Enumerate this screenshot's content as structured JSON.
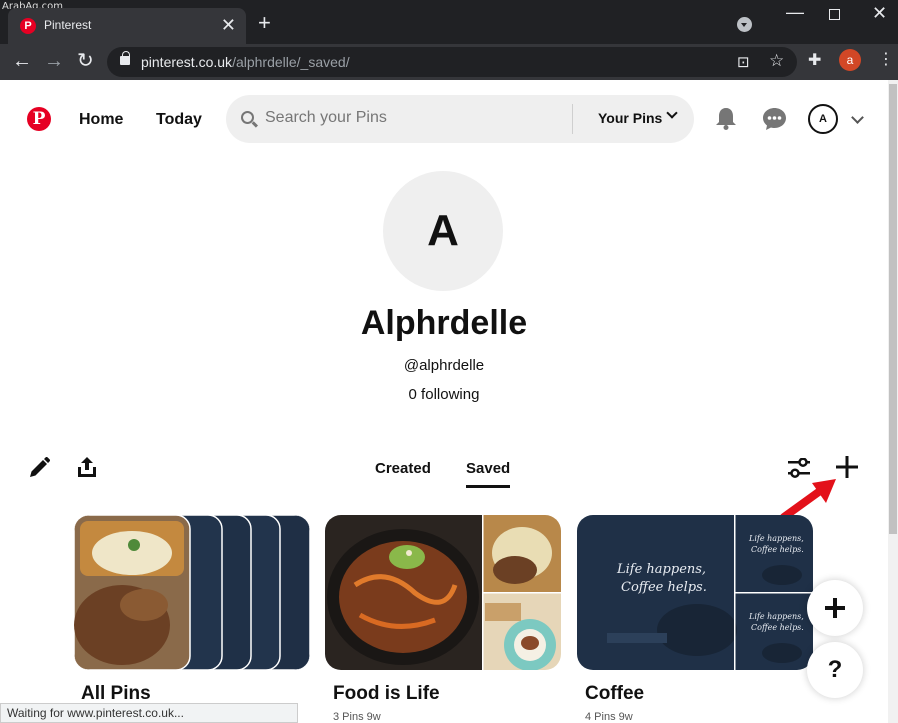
{
  "watermark": "ArabAq.com",
  "browser": {
    "tab_title": "Pinterest",
    "url_host": "pinterest.co.uk",
    "url_path": "/alphrdelle/_saved/",
    "profile_initial": "a",
    "status_text": "Waiting for www.pinterest.co.uk..."
  },
  "header": {
    "logo": "P",
    "nav": {
      "home": "Home",
      "today": "Today"
    },
    "search_placeholder": "Search your Pins",
    "scope": "Your Pins",
    "avatar_initial": "A"
  },
  "profile": {
    "avatar_initial": "A",
    "name": "Alphrdelle",
    "handle": "@alphrdelle",
    "following": "0 following"
  },
  "tabs": {
    "created": "Created",
    "saved": "Saved"
  },
  "boards": [
    {
      "title": "All Pins",
      "meta": ""
    },
    {
      "title": "Food is Life",
      "meta": "3 Pins  9w"
    },
    {
      "title": "Coffee",
      "meta": "4 Pins  9w"
    }
  ],
  "coffee_text": "Life happens, Coffee helps.",
  "fab": {
    "help": "?"
  },
  "colors": {
    "brand": "#e60023",
    "coffee_bg": "#1f3047"
  }
}
